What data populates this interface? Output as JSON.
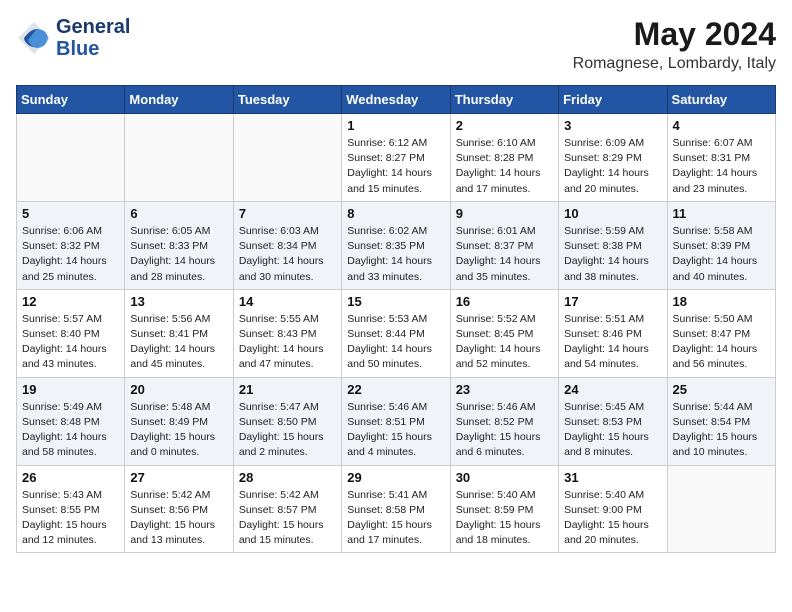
{
  "header": {
    "logo_line1": "General",
    "logo_line2": "Blue",
    "month": "May 2024",
    "location": "Romagnese, Lombardy, Italy"
  },
  "weekdays": [
    "Sunday",
    "Monday",
    "Tuesday",
    "Wednesday",
    "Thursday",
    "Friday",
    "Saturday"
  ],
  "weeks": [
    [
      {
        "day": "",
        "info": ""
      },
      {
        "day": "",
        "info": ""
      },
      {
        "day": "",
        "info": ""
      },
      {
        "day": "1",
        "info": "Sunrise: 6:12 AM\nSunset: 8:27 PM\nDaylight: 14 hours\nand 15 minutes."
      },
      {
        "day": "2",
        "info": "Sunrise: 6:10 AM\nSunset: 8:28 PM\nDaylight: 14 hours\nand 17 minutes."
      },
      {
        "day": "3",
        "info": "Sunrise: 6:09 AM\nSunset: 8:29 PM\nDaylight: 14 hours\nand 20 minutes."
      },
      {
        "day": "4",
        "info": "Sunrise: 6:07 AM\nSunset: 8:31 PM\nDaylight: 14 hours\nand 23 minutes."
      }
    ],
    [
      {
        "day": "5",
        "info": "Sunrise: 6:06 AM\nSunset: 8:32 PM\nDaylight: 14 hours\nand 25 minutes."
      },
      {
        "day": "6",
        "info": "Sunrise: 6:05 AM\nSunset: 8:33 PM\nDaylight: 14 hours\nand 28 minutes."
      },
      {
        "day": "7",
        "info": "Sunrise: 6:03 AM\nSunset: 8:34 PM\nDaylight: 14 hours\nand 30 minutes."
      },
      {
        "day": "8",
        "info": "Sunrise: 6:02 AM\nSunset: 8:35 PM\nDaylight: 14 hours\nand 33 minutes."
      },
      {
        "day": "9",
        "info": "Sunrise: 6:01 AM\nSunset: 8:37 PM\nDaylight: 14 hours\nand 35 minutes."
      },
      {
        "day": "10",
        "info": "Sunrise: 5:59 AM\nSunset: 8:38 PM\nDaylight: 14 hours\nand 38 minutes."
      },
      {
        "day": "11",
        "info": "Sunrise: 5:58 AM\nSunset: 8:39 PM\nDaylight: 14 hours\nand 40 minutes."
      }
    ],
    [
      {
        "day": "12",
        "info": "Sunrise: 5:57 AM\nSunset: 8:40 PM\nDaylight: 14 hours\nand 43 minutes."
      },
      {
        "day": "13",
        "info": "Sunrise: 5:56 AM\nSunset: 8:41 PM\nDaylight: 14 hours\nand 45 minutes."
      },
      {
        "day": "14",
        "info": "Sunrise: 5:55 AM\nSunset: 8:43 PM\nDaylight: 14 hours\nand 47 minutes."
      },
      {
        "day": "15",
        "info": "Sunrise: 5:53 AM\nSunset: 8:44 PM\nDaylight: 14 hours\nand 50 minutes."
      },
      {
        "day": "16",
        "info": "Sunrise: 5:52 AM\nSunset: 8:45 PM\nDaylight: 14 hours\nand 52 minutes."
      },
      {
        "day": "17",
        "info": "Sunrise: 5:51 AM\nSunset: 8:46 PM\nDaylight: 14 hours\nand 54 minutes."
      },
      {
        "day": "18",
        "info": "Sunrise: 5:50 AM\nSunset: 8:47 PM\nDaylight: 14 hours\nand 56 minutes."
      }
    ],
    [
      {
        "day": "19",
        "info": "Sunrise: 5:49 AM\nSunset: 8:48 PM\nDaylight: 14 hours\nand 58 minutes."
      },
      {
        "day": "20",
        "info": "Sunrise: 5:48 AM\nSunset: 8:49 PM\nDaylight: 15 hours\nand 0 minutes."
      },
      {
        "day": "21",
        "info": "Sunrise: 5:47 AM\nSunset: 8:50 PM\nDaylight: 15 hours\nand 2 minutes."
      },
      {
        "day": "22",
        "info": "Sunrise: 5:46 AM\nSunset: 8:51 PM\nDaylight: 15 hours\nand 4 minutes."
      },
      {
        "day": "23",
        "info": "Sunrise: 5:46 AM\nSunset: 8:52 PM\nDaylight: 15 hours\nand 6 minutes."
      },
      {
        "day": "24",
        "info": "Sunrise: 5:45 AM\nSunset: 8:53 PM\nDaylight: 15 hours\nand 8 minutes."
      },
      {
        "day": "25",
        "info": "Sunrise: 5:44 AM\nSunset: 8:54 PM\nDaylight: 15 hours\nand 10 minutes."
      }
    ],
    [
      {
        "day": "26",
        "info": "Sunrise: 5:43 AM\nSunset: 8:55 PM\nDaylight: 15 hours\nand 12 minutes."
      },
      {
        "day": "27",
        "info": "Sunrise: 5:42 AM\nSunset: 8:56 PM\nDaylight: 15 hours\nand 13 minutes."
      },
      {
        "day": "28",
        "info": "Sunrise: 5:42 AM\nSunset: 8:57 PM\nDaylight: 15 hours\nand 15 minutes."
      },
      {
        "day": "29",
        "info": "Sunrise: 5:41 AM\nSunset: 8:58 PM\nDaylight: 15 hours\nand 17 minutes."
      },
      {
        "day": "30",
        "info": "Sunrise: 5:40 AM\nSunset: 8:59 PM\nDaylight: 15 hours\nand 18 minutes."
      },
      {
        "day": "31",
        "info": "Sunrise: 5:40 AM\nSunset: 9:00 PM\nDaylight: 15 hours\nand 20 minutes."
      },
      {
        "day": "",
        "info": ""
      }
    ]
  ]
}
